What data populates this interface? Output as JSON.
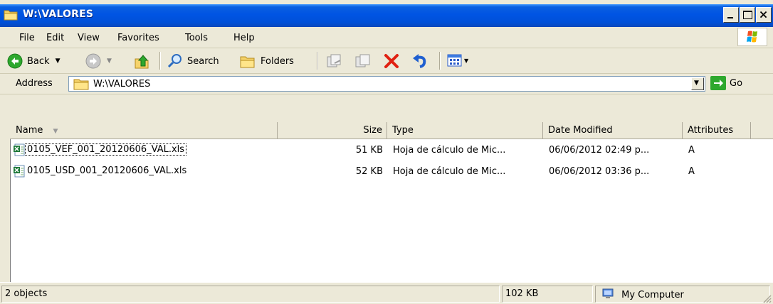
{
  "window": {
    "title": "W:\\VALORES",
    "caption_buttons": [
      "minimize-icon",
      "maximize-icon",
      "close-icon"
    ]
  },
  "menubar": {
    "items": [
      {
        "label": "File"
      },
      {
        "label": "Edit"
      },
      {
        "label": "View"
      },
      {
        "label": "Favorites"
      },
      {
        "label": "Tools"
      },
      {
        "label": "Help"
      }
    ]
  },
  "toolbar": {
    "back_label": "Back",
    "search_label": "Search",
    "folders_label": "Folders",
    "icons": [
      "back-icon",
      "forward-icon",
      "up-folder-icon",
      "search-icon",
      "folders-icon",
      "move-to-icon",
      "copy-to-icon",
      "delete-icon",
      "undo-icon",
      "views-icon"
    ]
  },
  "address": {
    "label": "Address",
    "value": "W:\\VALORES",
    "go_label": "Go"
  },
  "columns": [
    {
      "label": "Name"
    },
    {
      "label": "Size"
    },
    {
      "label": "Type"
    },
    {
      "label": "Date Modified"
    },
    {
      "label": "Attributes"
    }
  ],
  "files": [
    {
      "name": "0105_VEF_001_20120606_VAL.xls",
      "size": "51 KB",
      "type": "Hoja de cálculo de Mic...",
      "modified": "06/06/2012 02:49 p...",
      "attributes": "A"
    },
    {
      "name": "0105_USD_001_20120606_VAL.xls",
      "size": "52 KB",
      "type": "Hoja de cálculo de Mic...",
      "modified": "06/06/2012 03:36 p...",
      "attributes": "A"
    }
  ],
  "statusbar": {
    "count": "2 objects",
    "size": "102 KB",
    "location": "My Computer"
  },
  "colors": {
    "title_bar": "#0054e3",
    "chrome": "#ece9d8",
    "delete_red": "#e02010",
    "go_green": "#2ea82e"
  }
}
